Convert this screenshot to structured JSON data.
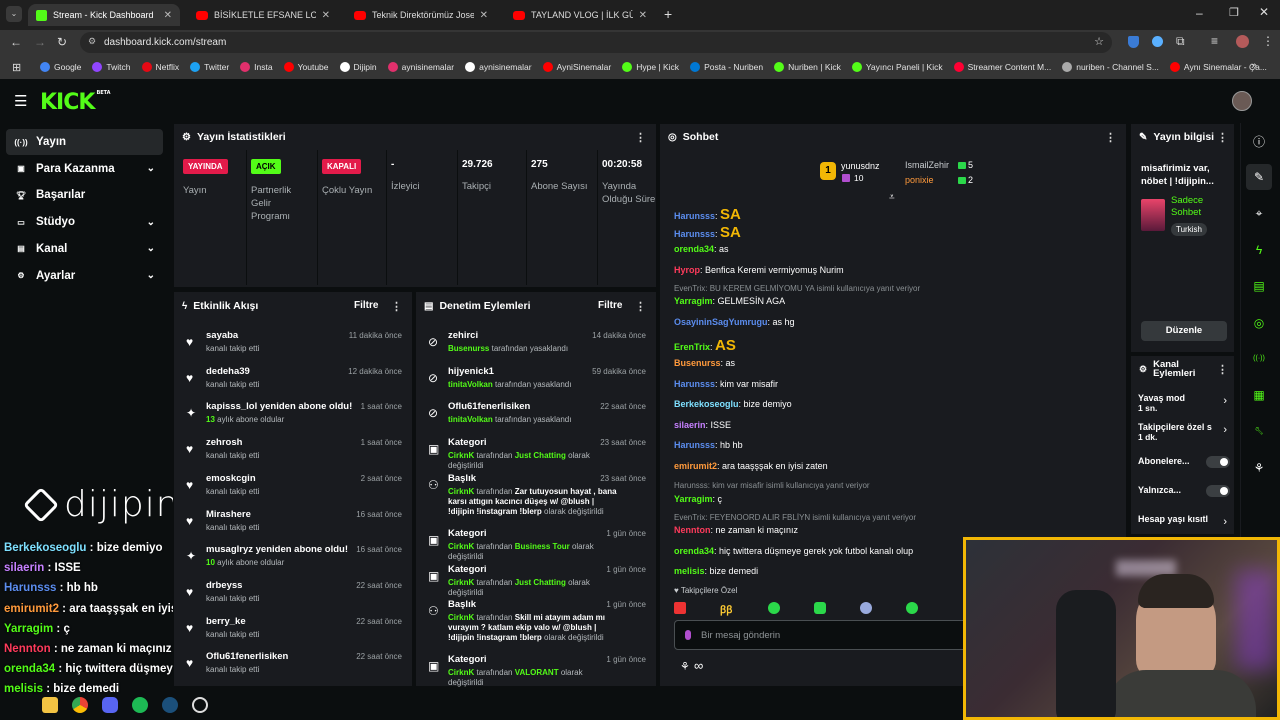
{
  "browser": {
    "tabs": [
      {
        "label": "Stream - Kick Dashboard",
        "type": "kick",
        "active": true
      },
      {
        "label": "BİSİKLETLE EFSANE LONDRA TU",
        "type": "youtube"
      },
      {
        "label": "Teknik Direktörümüz Jose Mou",
        "type": "youtube"
      },
      {
        "label": "TAYLAND VLOG | İLK GÜNÜMÜ",
        "type": "youtube"
      }
    ],
    "url": "dashboard.kick.com/stream",
    "bookmarks": [
      "Google",
      "Twitch",
      "Netflix",
      "Twitter",
      "Insta",
      "Youtube",
      "Dijipin",
      "aynisinemalar",
      "aynisinemalar",
      "AyniSinemalar",
      "Hype | Kick",
      "Posta - Nuriben",
      "Nuriben | Kick",
      "Yayıncı Paneli | Kick",
      "Streamer Content M...",
      "nuriben - Channel S...",
      "Aynı Sinemalar - Ça..."
    ],
    "bookmark_colors": [
      "#4285f4",
      "#9146ff",
      "#e50914",
      "#1da1f2",
      "#e1306c",
      "#ff0000",
      "#ffffff",
      "#e1306c",
      "#ffffff",
      "#ff0000",
      "#53fc18",
      "#0078d4",
      "#53fc18",
      "#53fc18",
      "#ff0033",
      "#aaaaaa",
      "#ff0000"
    ]
  },
  "header": {
    "logo": "KICK",
    "beta": "BETA"
  },
  "sidebar": {
    "items": [
      {
        "label": "Yayın",
        "icon": "broadcast-icon",
        "active": true,
        "expand": false
      },
      {
        "label": "Para Kazanma",
        "icon": "money-icon",
        "expand": true
      },
      {
        "label": "Başarılar",
        "icon": "trophy-icon",
        "expand": false
      },
      {
        "label": "Stüdyo",
        "icon": "studio-icon",
        "expand": true
      },
      {
        "label": "Kanal",
        "icon": "channel-icon",
        "expand": true
      },
      {
        "label": "Ayarlar",
        "icon": "gear-icon",
        "expand": true
      }
    ]
  },
  "stats": {
    "title": "Yayın İstatistikleri",
    "items": [
      {
        "badge": "YAYINDA",
        "badge_bg": "#e31b4a",
        "badge_fg": "#ffffff",
        "label": "Yayın"
      },
      {
        "badge": "AÇIK",
        "badge_bg": "#53fc18",
        "badge_fg": "#000000",
        "label": "Partnerlik Gelir Programı"
      },
      {
        "badge": "KAPALI",
        "badge_bg": "#e31b4a",
        "badge_fg": "#ffffff",
        "label": "Çoklu Yayın"
      },
      {
        "value": "-",
        "label": "İzleyici"
      },
      {
        "value": "29.726",
        "label": "Takipçi"
      },
      {
        "value": "275",
        "label": "Abone Sayısı"
      },
      {
        "value": "00:20:58",
        "label": "Yayında Olduğu Süre"
      }
    ]
  },
  "activity": {
    "title": "Etkinlik Akışı",
    "filter": "Filtre",
    "events": [
      {
        "icon": "heart",
        "name": "sayaba",
        "sub": "kanalı takip etti",
        "time": "11 dakika önce"
      },
      {
        "icon": "heart",
        "name": "dedeha39",
        "sub": "kanalı takip etti",
        "time": "12 dakika önce"
      },
      {
        "icon": "star",
        "name": "kapisss_lol yeniden abone oldu!",
        "sub_green": "13",
        "sub": "aylık abone oldular",
        "time": "1 saat önce"
      },
      {
        "icon": "heart",
        "name": "zehrosh",
        "sub": "kanalı takip etti",
        "time": "1 saat önce"
      },
      {
        "icon": "heart",
        "name": "emoskcgin",
        "sub": "kanalı takip etti",
        "time": "2 saat önce"
      },
      {
        "icon": "heart",
        "name": "Mirashere",
        "sub": "kanalı takip etti",
        "time": "16 saat önce"
      },
      {
        "icon": "star",
        "name": "musaglryz yeniden abone oldu!",
        "sub_green": "10",
        "sub": "aylık abone oldular",
        "time": "16 saat önce"
      },
      {
        "icon": "heart",
        "name": "drbeyss",
        "sub": "kanalı takip etti",
        "time": "22 saat önce"
      },
      {
        "icon": "heart",
        "name": "berry_ke",
        "sub": "kanalı takip etti",
        "time": "22 saat önce"
      },
      {
        "icon": "heart",
        "name": "Oflu61fenerlisiken",
        "sub": "kanalı takip etti",
        "time": "22 saat önce"
      }
    ]
  },
  "moderation": {
    "title": "Denetim Eylemleri",
    "filter": "Filtre",
    "events": [
      {
        "icon": "ban",
        "name": "zehirci",
        "actor": "Busenurss",
        "text": "tarafından yasaklandı",
        "time": "14 dakika önce"
      },
      {
        "icon": "ban",
        "name": "hijyenick1",
        "actor": "tinitaVolkan",
        "text": "tarafından yasaklandı",
        "time": "59 dakika önce"
      },
      {
        "icon": "ban",
        "name": "Oflu61fenerlisiken",
        "actor": "tinitaVolkan",
        "text": "tarafından yasaklandı",
        "time": "22 saat önce"
      },
      {
        "icon": "cat",
        "name": "Kategori",
        "actor": "CirknK",
        "text": "tarafından",
        "value": "Just Chatting",
        "tail": "olarak değiştirildi",
        "time": "23 saat önce"
      },
      {
        "icon": "title",
        "name": "Başlık",
        "actor": "CirknK",
        "text": "tarafından",
        "value": "Zar tutuyosun hayat , bana karsı attıgın kacıncı düşeş w/ @blush | !dijipin !instagram !blerp",
        "tail": "olarak değiştirildi",
        "time": "23 saat önce",
        "tall": true
      },
      {
        "icon": "cat",
        "name": "Kategori",
        "actor": "CirknK",
        "text": "tarafından",
        "value": "Business Tour",
        "tail": "olarak değiştirildi",
        "time": "1 gün önce"
      },
      {
        "icon": "cat",
        "name": "Kategori",
        "actor": "CirknK",
        "text": "tarafından",
        "value": "Just Chatting",
        "tail": "olarak değiştirildi",
        "time": "1 gün önce"
      },
      {
        "icon": "title",
        "name": "Başlık",
        "actor": "CirknK",
        "text": "tarafından",
        "value": "Skill mi atayım adam mı vurayım ? katlam ekip valo w/ @blush | !dijipin !instagram !blerp",
        "tail": "olarak değiştirildi",
        "time": "1 gün önce",
        "tall": true
      },
      {
        "icon": "cat",
        "name": "Kategori",
        "actor": "CirknK",
        "text": "tarafından",
        "value": "VALORANT",
        "tail": "olarak değiştirildi",
        "time": "1 gün önce"
      }
    ]
  },
  "chat": {
    "title": "Sohbet",
    "top_gifters": [
      {
        "rank": "1",
        "name": "yunusdnz",
        "count": "10"
      },
      {
        "name": "IsmailZehir",
        "count": "5"
      },
      {
        "name": "ponixie",
        "count": "2"
      }
    ],
    "messages": [
      {
        "user": "Harunsss",
        "color": "#5b8def",
        "text": "SA",
        "big": true
      },
      {
        "user": "Harunsss",
        "color": "#5b8def",
        "text": "SA",
        "big": true
      },
      {
        "user": "orenda34",
        "color": "#53fc18",
        "text": "as"
      },
      {
        "user": "Hyrop",
        "color": "#ff3b5c",
        "text": "Benfica Keremi vermiyomuş Nurim"
      },
      {
        "reply": "EvenTrix: BU KEREM GELMİYOMU YA isimli kullanıcıya yanıt veriyor"
      },
      {
        "user": "Yarragim",
        "color": "#53fc18",
        "text": "GELMESİN AGA"
      },
      {
        "user": "OsayininSagYumrugu",
        "color": "#5b8def",
        "text": "as hg"
      },
      {
        "user": "ErenTrix",
        "color": "#53fc18",
        "text": "AS",
        "big": true
      },
      {
        "user": "Busenurss",
        "color": "#ff9a3c",
        "text": "as"
      },
      {
        "user": "Harunsss",
        "color": "#5b8def",
        "text": "kim var misafir"
      },
      {
        "user": "Berkekoseoglu",
        "color": "#7ee0ff",
        "text": "bize demiyo"
      },
      {
        "user": "silaerin",
        "color": "#c680ff",
        "text": "ISSE"
      },
      {
        "user": "Harunsss",
        "color": "#5b8def",
        "text": "hb hb"
      },
      {
        "user": "emirumit2",
        "color": "#ff9a3c",
        "text": "ara taaşşşak en iyisi zaten"
      },
      {
        "reply": "Harunsss: kim var misafir isimli kullanıcıya yanıt veriyor"
      },
      {
        "user": "Yarragim",
        "color": "#53fc18",
        "text": "ç"
      },
      {
        "reply": "EvenTrix: FEYENOORD ALIR FBLİYN isimli kullanıcıya yanıt veriyor"
      },
      {
        "user": "Nennton",
        "color": "#ff3b5c",
        "text": "ne zaman ki maçınız"
      },
      {
        "user": "orenda34",
        "color": "#53fc18",
        "text": "hiç twittera düşmeye gerek yok futbol kanalı olup"
      },
      {
        "user": "melisis",
        "color": "#53fc18",
        "text": "bize demedi"
      }
    ],
    "follower_label": "Takipçilere Özel",
    "input_placeholder": "Bir mesaj gönderin"
  },
  "stream_info": {
    "title": "Yayın bilgisi",
    "stream_title": "misafirimiz var, nöbet | !dijipin...",
    "chat_mode": "Sadece Sohbet",
    "language": "Turkish",
    "edit_button": "Düzenle"
  },
  "channel_actions": {
    "title": "Kanal Eylemleri",
    "items": [
      {
        "label": "Yavaş mod",
        "sub": "1 sn.",
        "type": "chevron"
      },
      {
        "label": "Takipçilere özel s",
        "sub": "1 dk.",
        "type": "chevron"
      },
      {
        "label": "Abonelere...",
        "type": "toggle"
      },
      {
        "label": "Yalnızca...",
        "type": "toggle"
      },
      {
        "label": "Hesap yaşı kısıtl",
        "type": "chevron"
      }
    ]
  },
  "overlay": {
    "brand": "dijipin",
    "chat": [
      {
        "user": "Berkekoseoglu",
        "color": "#7ee0ff",
        "text": "bize demiyo"
      },
      {
        "user": "silaerin",
        "color": "#c680ff",
        "text": "ISSE"
      },
      {
        "user": "Harunsss",
        "color": "#5b8def",
        "text": "hb hb"
      },
      {
        "user": "emirumit2",
        "color": "#ff9a3c",
        "text": "ara taaşşşak en iyisi zaten"
      },
      {
        "user": "Yarragim",
        "color": "#53fc18",
        "text": "ç"
      },
      {
        "user": "Nennton",
        "color": "#ff3b5c",
        "text": "ne zaman ki maçınız"
      },
      {
        "user": "orenda34",
        "color": "#53fc18",
        "text": "hiç twittera düşmeye gerek yok futbol kanalı olup"
      },
      {
        "user": "melisis",
        "color": "#53fc18",
        "text": "bize demedi"
      }
    ]
  }
}
